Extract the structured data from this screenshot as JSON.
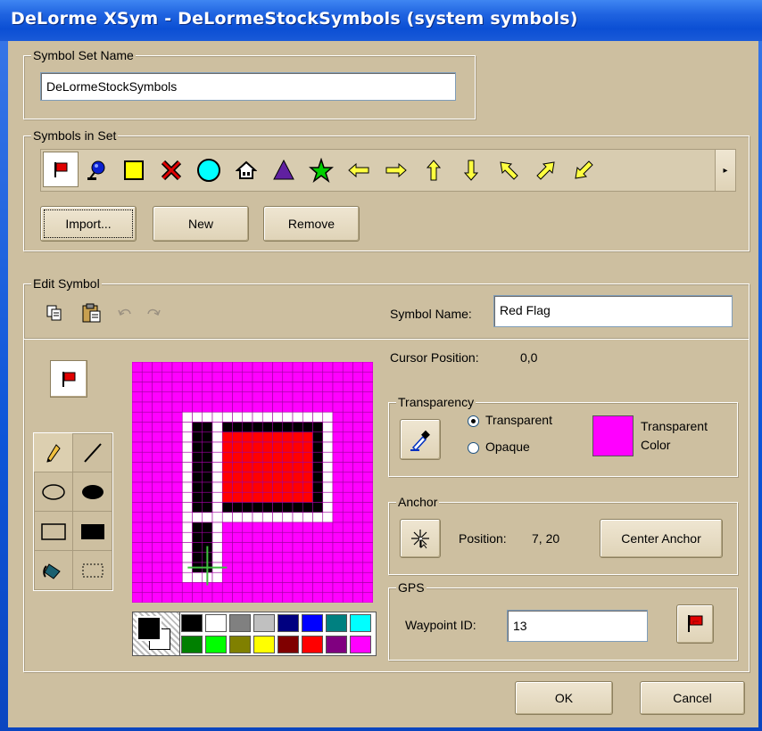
{
  "window": {
    "title": "DeLorme XSym - DeLormeStockSymbols (system symbols)"
  },
  "symbol_set": {
    "legend": "Symbol Set Name",
    "name": "DeLormeStockSymbols"
  },
  "symbols_in_set": {
    "legend": "Symbols in Set",
    "icons": [
      "red-flag-icon",
      "blue-pin-icon",
      "yellow-square-icon",
      "red-x-icon",
      "cyan-circle-icon",
      "house-icon",
      "purple-triangle-icon",
      "green-star-icon",
      "arrow-left-icon",
      "arrow-right-icon",
      "arrow-up-icon",
      "arrow-down-icon",
      "arrow-up-left-icon",
      "arrow-up-right-icon",
      "arrow-down-left-icon"
    ],
    "scroll_right": "▸",
    "buttons": {
      "import": "Import...",
      "new": "New",
      "remove": "Remove"
    }
  },
  "edit_symbol": {
    "legend": "Edit Symbol",
    "toolbar_icons": [
      "copy-icon",
      "paste-icon",
      "undo-icon",
      "redo-icon"
    ],
    "symbol_name_label": "Symbol Name:",
    "symbol_name_value": "Red Flag",
    "cursor_position_label": "Cursor Position:",
    "cursor_position_value": "0,0",
    "tools": [
      "pencil-tool-icon",
      "line-tool-icon",
      "ellipse-outline-tool-icon",
      "ellipse-filled-tool-icon",
      "rect-outline-tool-icon",
      "rect-filled-tool-icon",
      "fill-bucket-tool-icon",
      "select-tool-icon"
    ],
    "palette": [
      "#000000",
      "#ffffff",
      "#808080",
      "#c0c0c0",
      "#000080",
      "#0000ff",
      "#008080",
      "#00ffff",
      "#008000",
      "#00ff00",
      "#808000",
      "#ffff00",
      "#800000",
      "#ff0000",
      "#800080",
      "#ff00ff"
    ],
    "primary_color": "#000000",
    "secondary_color": "#ffffff",
    "canvas_background": "#ff00ff"
  },
  "transparency": {
    "legend": "Transparency",
    "options": [
      "Transparent",
      "Opaque"
    ],
    "selected": "Transparent",
    "color_label_line1": "Transparent",
    "color_label_line2": "Color",
    "color": "#ff00ff"
  },
  "anchor": {
    "legend": "Anchor",
    "position_label": "Position:",
    "position_value": "7, 20",
    "center_button": "Center Anchor"
  },
  "gps": {
    "legend": "GPS",
    "waypoint_label": "Waypoint ID:",
    "waypoint_value": "13"
  },
  "dialog_buttons": {
    "ok": "OK",
    "cancel": "Cancel"
  }
}
